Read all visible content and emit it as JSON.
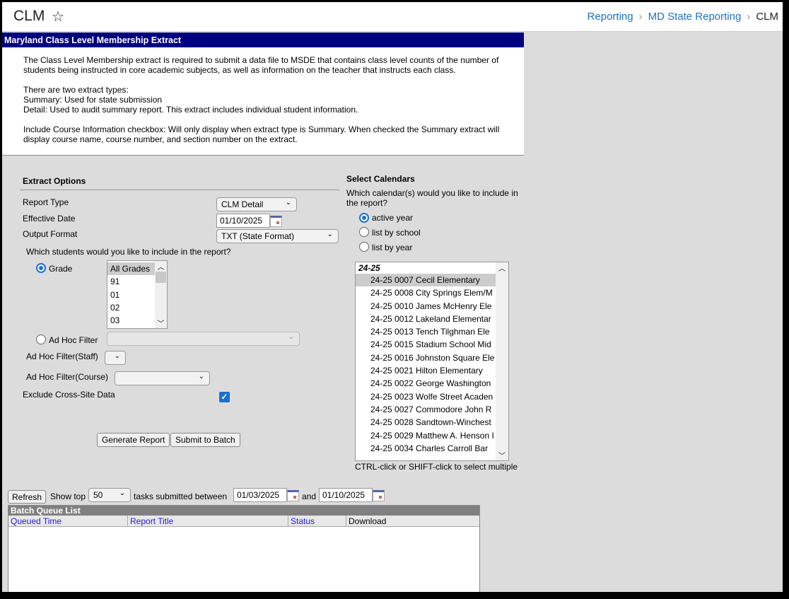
{
  "header": {
    "title": "CLM",
    "favorite_icon": "star-outline-icon",
    "breadcrumbs": [
      "Reporting",
      "MD State Reporting",
      "CLM"
    ]
  },
  "panel_title": "Maryland Class Level Membership Extract",
  "description": {
    "p1": "The Class Level Membership extract is required to submit a data file to MSDE that contains class level counts of the number of students being instructed in core academic subjects, as well as information on the teacher that instructs each class.",
    "p2_lines": [
      "There are two extract types:",
      "Summary: Used for state submission",
      "Detail: Used to audit summary report. This extract includes individual student information."
    ],
    "p3": "Include Course Information checkbox: Will only display when extract type is Summary. When checked the Summary extract will display course name, course number, and section number on the extract."
  },
  "extract_options": {
    "heading": "Extract Options",
    "report_type_label": "Report Type",
    "report_type_value": "CLM Detail",
    "effective_date_label": "Effective Date",
    "effective_date_value": "01/10/2025",
    "output_format_label": "Output Format",
    "output_format_value": "TXT (State Format)",
    "students_question": "Which students would you like to include in the report?",
    "grade_label": "Grade",
    "grade_selected": true,
    "grades": [
      "All Grades",
      "91",
      "01",
      "02",
      "03"
    ],
    "adhoc_label": "Ad Hoc Filter",
    "adhoc_value": "",
    "adhoc_staff_label": "Ad Hoc Filter(Staff)",
    "adhoc_staff_value": "",
    "adhoc_course_label": "Ad Hoc Filter(Course)",
    "adhoc_course_value": "",
    "exclude_cross_site_label": "Exclude Cross-Site Data",
    "exclude_cross_site_checked": true,
    "generate_label": "Generate Report",
    "submit_batch_label": "Submit to Batch"
  },
  "calendars": {
    "heading": "Select Calendars",
    "question": "Which calendar(s) would you like to include in the report?",
    "options": [
      "active year",
      "list by school",
      "list by year"
    ],
    "selected_option": "active year",
    "group": "24-25",
    "items": [
      "24-25 0007 Cecil Elementary",
      "24-25 0008 City Springs Elem/M",
      "24-25 0010 James McHenry Ele",
      "24-25 0012 Lakeland Elementar",
      "24-25 0013 Tench Tilghman Ele",
      "24-25 0015 Stadium School Mid",
      "24-25 0016 Johnston Square Ele",
      "24-25 0021 Hilton Elementary",
      "24-25 0022 George Washington",
      "24-25 0023 Wolfe Street Acaden",
      "24-25 0027 Commodore John R",
      "24-25 0028 Sandtown-Winchest",
      "24-25 0029 Matthew A. Henson I",
      "24-25 0034 Charles Carroll Bar"
    ],
    "hint": "CTRL-click or SHIFT-click to select multiple"
  },
  "batch": {
    "refresh_label": "Refresh",
    "show_top_label": "Show top",
    "show_top_value": "50",
    "between_label": "tasks submitted between",
    "from_date": "01/03/2025",
    "and_label": "and",
    "to_date": "01/10/2025",
    "list_title": "Batch Queue List",
    "columns": [
      "Queued Time",
      "Report Title",
      "Status",
      "Download"
    ]
  }
}
